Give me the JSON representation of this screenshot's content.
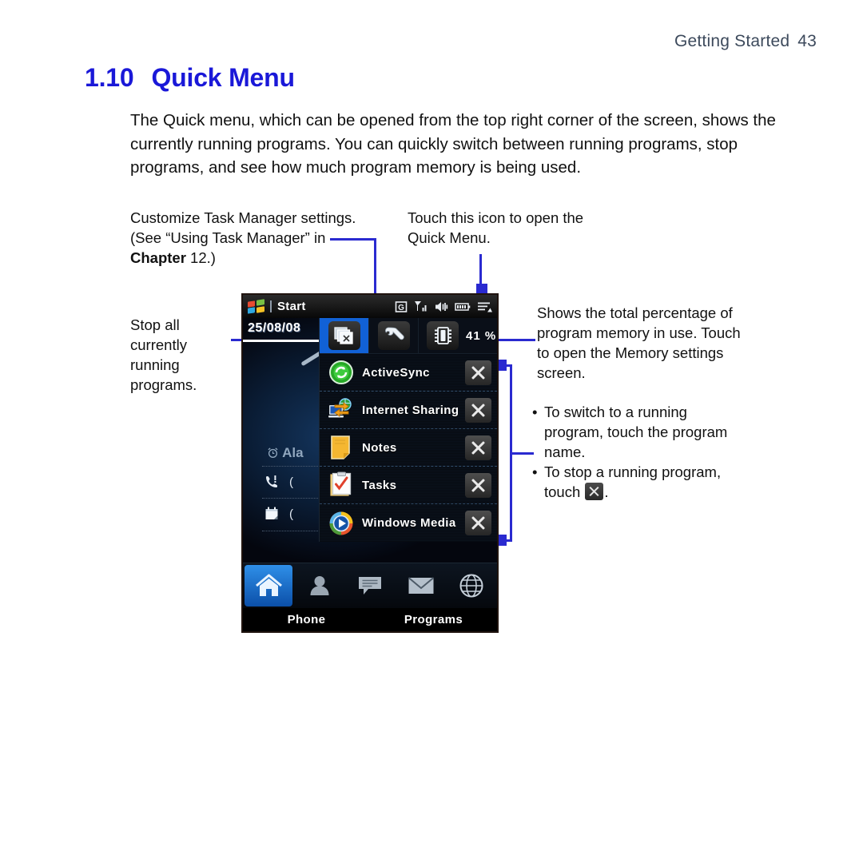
{
  "header": {
    "title": "Getting Started",
    "page_number": "43"
  },
  "section": {
    "number": "1.10",
    "title": "Quick Menu"
  },
  "intro": "The Quick menu, which can be opened from the top right corner of the screen, shows the currently running programs. You can quickly switch between running programs, stop programs, and see how much program memory is being used.",
  "annotations": {
    "customize": {
      "line1": "Customize Task Manager settings.",
      "line2": "(See “Using Task Manager” in",
      "bold_word": "Chapter",
      "line3_rest": " 12.)"
    },
    "touch_icon": "Touch this icon to open the Quick Menu.",
    "stop_all": "Stop all currently running programs.",
    "memory": "Shows the total percentage of program memory in use. Touch to open the Memory settings screen.",
    "bullets": [
      {
        "text_before": "To switch to a running program, touch the program name.",
        "icon": null,
        "text_after": ""
      },
      {
        "text_before": "To stop a running program, touch ",
        "icon": "close-x-icon",
        "text_after": "."
      }
    ]
  },
  "phone": {
    "titlebar": {
      "logo": "windows-logo-icon",
      "start_label": "Start",
      "status_icons": [
        "gprs-g-icon",
        "signal-strength-icon",
        "volume-icon",
        "battery-icon",
        "quick-menu-icon"
      ]
    },
    "home": {
      "date": "25/08/08",
      "alarm_label": "Ala",
      "rows": [
        "missed-call-icon",
        "calendar-icon"
      ]
    },
    "quick_menu": {
      "buttons": [
        {
          "name": "close-all-programs",
          "icon": "stacked-windows-close-icon",
          "selected": true
        },
        {
          "name": "task-manager-settings",
          "icon": "wrench-icon",
          "selected": false
        }
      ],
      "memory": {
        "icon": "memory-chip-icon",
        "value": "41",
        "unit": "%"
      },
      "programs": [
        {
          "name": "ActiveSync",
          "icon": "activesync-icon",
          "close": "close-x-icon"
        },
        {
          "name": "Internet Sharing",
          "icon": "internet-sharing-icon",
          "close": "close-x-icon"
        },
        {
          "name": "Notes",
          "icon": "notes-icon",
          "close": "close-x-icon"
        },
        {
          "name": "Tasks",
          "icon": "tasks-icon",
          "close": "close-x-icon"
        },
        {
          "name": "Windows Media",
          "icon": "windows-media-icon",
          "close": "close-x-icon"
        }
      ]
    },
    "taskbar": [
      "home-icon",
      "people-icon",
      "messages-icon",
      "mail-icon",
      "internet-icon"
    ],
    "softkeys": {
      "left": "Phone",
      "right": "Programs"
    }
  },
  "colors": {
    "title_blue": "#1a18d8",
    "header_gray": "#3d4a5c",
    "callout_blue": "#2a2ad0",
    "selection_blue": "#1161d6"
  }
}
